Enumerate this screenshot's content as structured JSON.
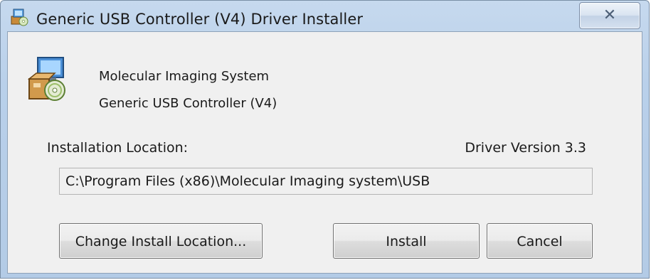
{
  "window": {
    "title": "Generic USB Controller (V4) Driver Installer",
    "close_glyph": "✕",
    "title_icon": "installer-icon"
  },
  "header": {
    "app_icon": "setup-box-cd-icon",
    "product_name": "Molecular Imaging System",
    "component_name": "Generic USB Controller (V4)"
  },
  "install": {
    "location_label": "Installation Location:",
    "driver_version": "Driver Version 3.3",
    "path_value": "C:\\Program Files (x86)\\Molecular Imaging system\\USB"
  },
  "buttons": {
    "change_location": "Change Install Location...",
    "install": "Install",
    "cancel": "Cancel"
  },
  "colors": {
    "title_bar": "#b9d0ea",
    "client_bg": "#f0f0f0",
    "button_border": "#707070"
  }
}
